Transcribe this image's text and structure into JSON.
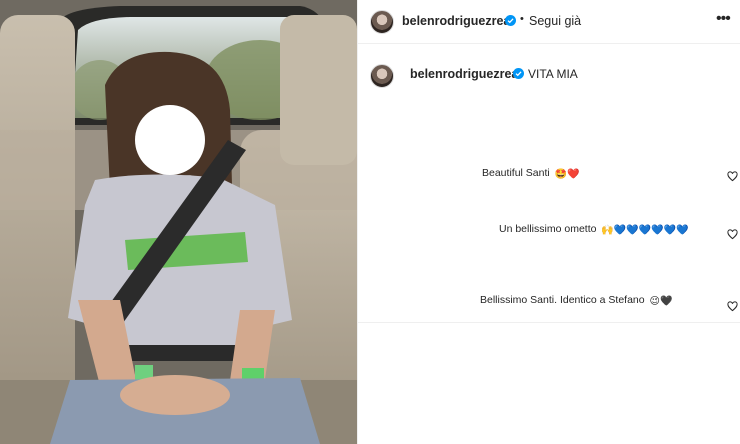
{
  "post": {
    "author": {
      "username": "belenrodriguezreal",
      "verified_icon": "verified-badge-icon",
      "follow_label": "Segui già",
      "separator": "•"
    },
    "more_label": "•••",
    "caption": {
      "username": "belenrodriguezreal",
      "text": "VITA MIA"
    },
    "comments": [
      {
        "text": "Beautiful Santi",
        "emojis": "🤩❤️"
      },
      {
        "text": "Un bellissimo ometto",
        "emojis": "🙌💙💙💙💙💙💙"
      },
      {
        "text": "Bellissimo Santi. Identico a Stefano",
        "emojis": "😉🖤"
      }
    ]
  },
  "colors": {
    "verified": "#0095f6",
    "separator": "#efefef",
    "text": "#262626"
  }
}
